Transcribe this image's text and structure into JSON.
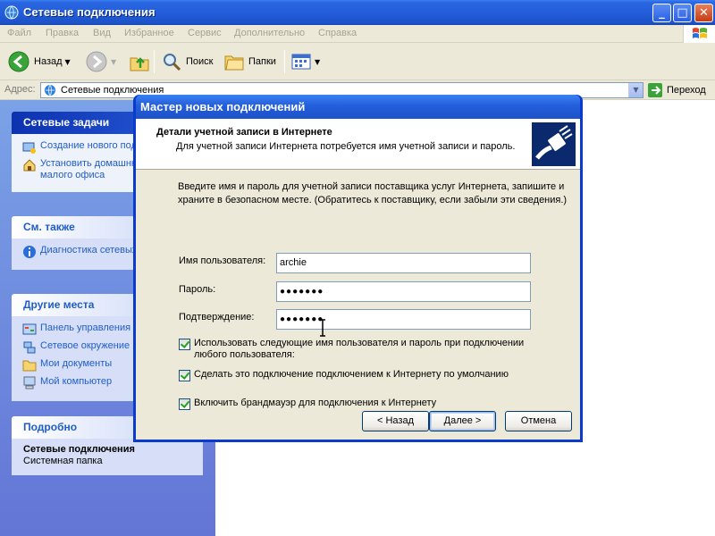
{
  "window": {
    "title": "Сетевые подключения",
    "controls": {
      "minimize": "_",
      "maximize": "□",
      "close": "✕"
    }
  },
  "menubar": {
    "items": [
      "Файл",
      "Правка",
      "Вид",
      "Избранное",
      "Сервис",
      "Дополнительно",
      "Справка"
    ]
  },
  "toolbar": {
    "back_label": "Назад",
    "search_label": "Поиск",
    "folders_label": "Папки",
    "icons": [
      "back-arrow-icon",
      "forward-arrow-icon",
      "folder-up-icon",
      "search-icon",
      "folders-icon",
      "views-icon"
    ]
  },
  "addressbar": {
    "label": "Адрес:",
    "value": "Сетевые подключения",
    "go_label": "Переход"
  },
  "taskpane": {
    "network_tasks": {
      "title": "Сетевые задачи",
      "items": [
        {
          "label": "Создание нового подключения",
          "icon": "new-connection-icon"
        },
        {
          "label": "Установить домашнюю или сеть малого офиса",
          "icon": "home-network-icon"
        }
      ]
    },
    "see_also": {
      "title": "См. также",
      "items": [
        {
          "label": "Диагностика сетевых неполадок",
          "icon": "info-icon"
        }
      ]
    },
    "other_places": {
      "title": "Другие места",
      "items": [
        {
          "label": "Панель управления",
          "icon": "control-panel-icon"
        },
        {
          "label": "Сетевое окружение",
          "icon": "network-places-icon"
        },
        {
          "label": "Мои документы",
          "icon": "folder-icon"
        },
        {
          "label": "Мой компьютер",
          "icon": "computer-icon"
        }
      ]
    },
    "details": {
      "title": "Подробно",
      "name": "Сетевые подключения",
      "type": "Системная папка"
    }
  },
  "dialog": {
    "title": "Мастер новых подключений",
    "heading": "Детали учетной записи в Интернете",
    "subheading": "Для учетной записи Интернета потребуется имя учетной записи и пароль.",
    "intro": "Введите имя и пароль для учетной записи поставщика услуг Интернета, запишите и храните в безопасном месте. (Обратитесь к поставщику, если забыли эти сведения.)",
    "username_label": "Имя пользователя:",
    "username_value": "archie",
    "password_label": "Пароль:",
    "password_value": "●●●●●●●",
    "confirm_label": "Подтверждение:",
    "confirm_value": "●●●●●●●",
    "checkboxes": [
      {
        "label": "Использовать следующие имя пользователя и пароль при подключении любого пользователя:",
        "checked": true
      },
      {
        "label": "Сделать это подключение подключением к Интернету по умолчанию",
        "checked": true
      },
      {
        "label": "Включить брандмауэр для подключения к Интернету",
        "checked": true
      }
    ],
    "buttons": {
      "back": "< Назад",
      "next": "Далее >",
      "cancel": "Отмена"
    }
  },
  "colors": {
    "titlebar": "#245edb",
    "taskpane": "#6f8ee0",
    "link": "#215dc6",
    "chrome": "#ece9d8"
  }
}
